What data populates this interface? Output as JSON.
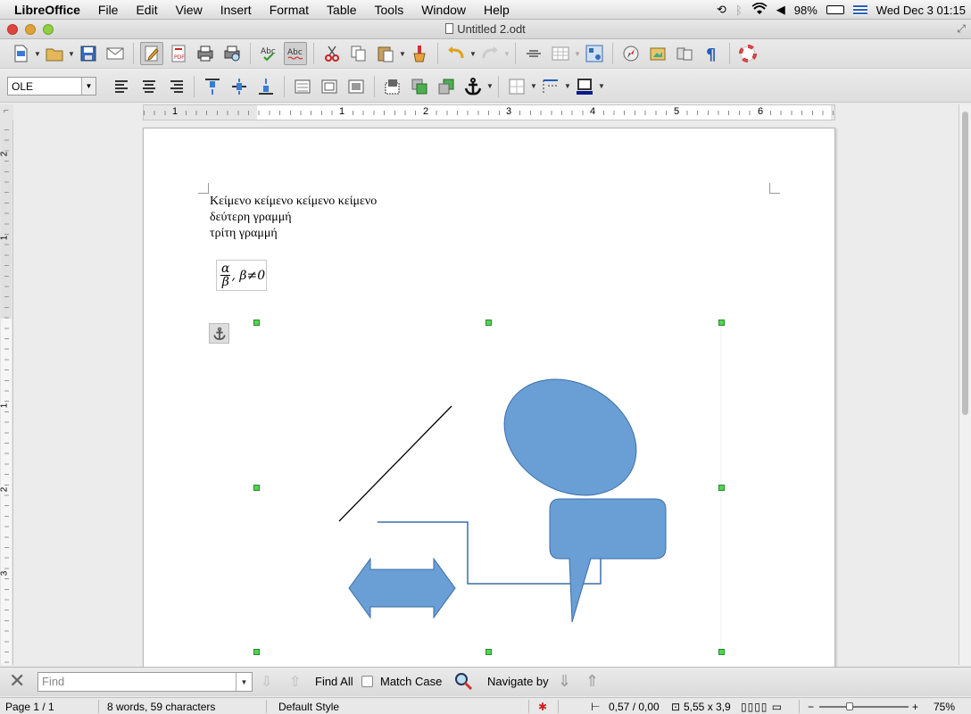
{
  "menubar": {
    "app": "LibreOffice",
    "items": [
      "File",
      "Edit",
      "View",
      "Insert",
      "Format",
      "Table",
      "Tools",
      "Window",
      "Help"
    ],
    "battery": "98%",
    "datetime": "Wed Dec 3  01:15"
  },
  "window": {
    "title": "Untitled 2.odt"
  },
  "format_toolbar": {
    "style_value": "OLE"
  },
  "document": {
    "lines": [
      "Κείμενο κείμενο κείμενο κείμενο",
      "δεύτερη γραμμή",
      "τρίτη γραμμή"
    ],
    "formula": {
      "numerator": "α",
      "denominator": "β",
      "rest": ", β≠0"
    }
  },
  "ruler": {
    "h_labels": [
      "1",
      "1",
      "2",
      "3",
      "4",
      "5",
      "6"
    ],
    "v_labels": [
      "2",
      "1",
      "1",
      "2",
      "3"
    ]
  },
  "findbar": {
    "placeholder": "Find",
    "find_all": "Find All",
    "match_case": "Match Case",
    "navigate_by": "Navigate by"
  },
  "statusbar": {
    "page": "Page 1 / 1",
    "words": "8 words, 59 characters",
    "style": "Default Style",
    "position": "0,57 / 0,00",
    "size": "5,55 x 3,9",
    "zoom": "75%"
  },
  "colors": {
    "shape_fill": "#6a9fd5",
    "shape_stroke": "#3c6ea8",
    "handle": "#4fd64f"
  }
}
